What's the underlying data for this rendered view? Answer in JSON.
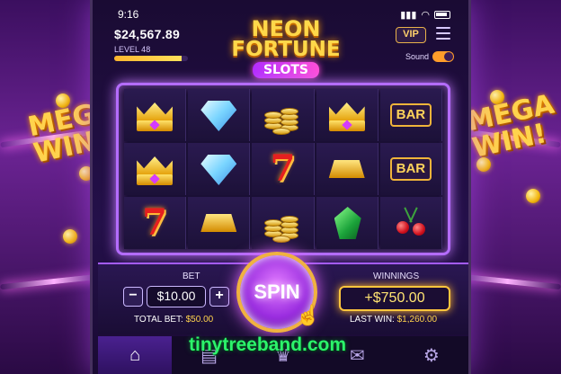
{
  "status": {
    "time": "9:16"
  },
  "header": {
    "balance": "$24,567.89",
    "level": "LEVEL 48",
    "level_progress": 0.92,
    "vip_label": "VIP",
    "sound_label": "Sound",
    "sound_on": true
  },
  "logo": {
    "line1": "NEON",
    "line2": "FORTUNE",
    "line3": "SLOTS"
  },
  "background": {
    "mega_left": "MEGA WIN!",
    "mega_right": "MEGA WIN!"
  },
  "reels": {
    "rows": [
      [
        "crown",
        "diamond",
        "coins",
        "crown",
        "bar"
      ],
      [
        "crown",
        "diamond",
        "seven",
        "gold-bar",
        "bar"
      ],
      [
        "seven",
        "gold-bar",
        "coins",
        "emerald",
        "cherries"
      ]
    ],
    "bar_text": "BAR",
    "seven_text": "7"
  },
  "bet": {
    "label": "BET",
    "value": "$10.00",
    "minus": "−",
    "plus": "+",
    "total_label": "TOTAL BET:",
    "total_value": "$50.00"
  },
  "spin": {
    "label": "SPIN"
  },
  "winnings": {
    "label": "WINNINGS",
    "value": "+$750.00",
    "last_label": "LAST WIN:",
    "last_value": "$1,260.00"
  },
  "nav": {
    "items": [
      "home-icon",
      "cards-icon",
      "trophy-icon",
      "gift-icon",
      "settings-icon"
    ]
  },
  "watermark": "tinytreeband.com",
  "colors": {
    "accent": "#b46cff",
    "gold": "#ffd34d",
    "bg": "#24104a"
  }
}
